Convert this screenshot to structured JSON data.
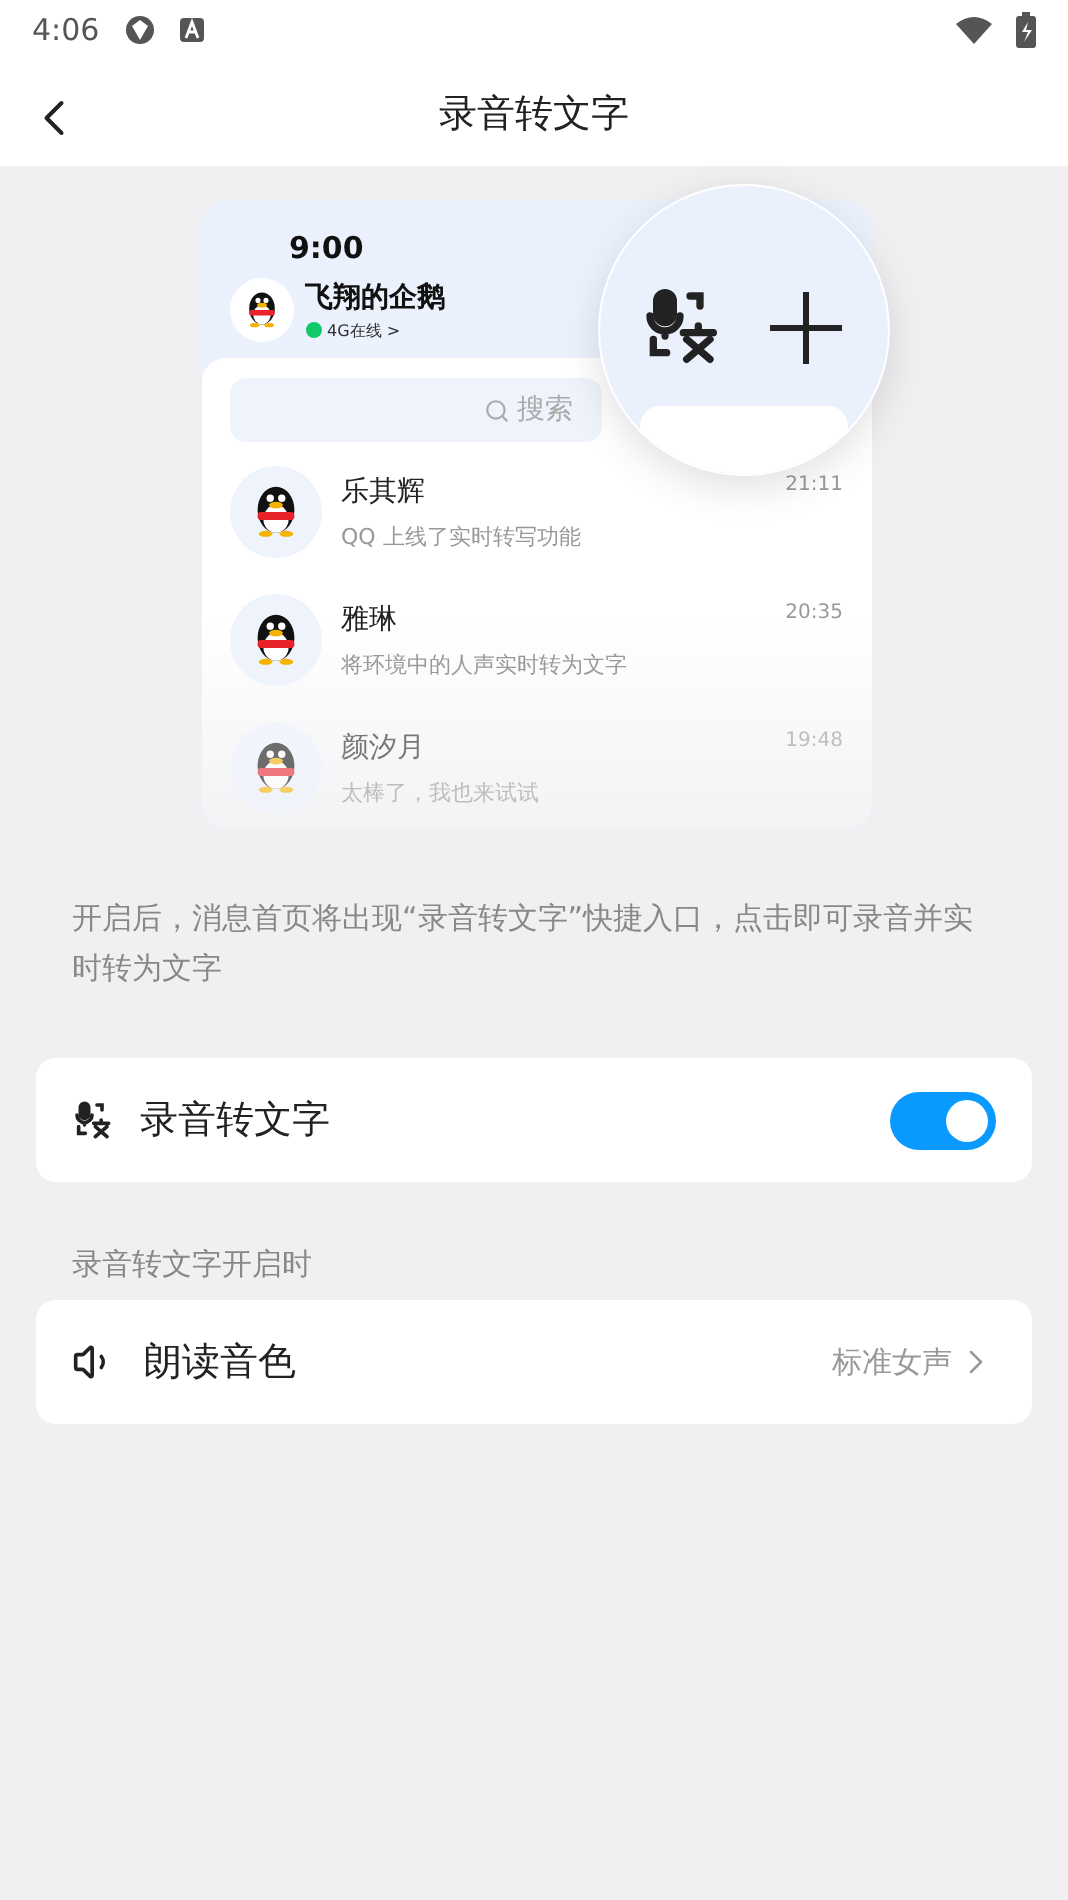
{
  "status_bar": {
    "time": "4:06"
  },
  "header": {
    "title": "录音转文字"
  },
  "preview": {
    "time": "9:00",
    "profile": {
      "name": "飞翔的企鹅",
      "status": "4G在线 >"
    },
    "search_placeholder": "搜索",
    "chats": [
      {
        "name": "乐其辉",
        "message": "QQ 上线了实时转写功能",
        "time": "21:11",
        "faded": false
      },
      {
        "name": "雅琳",
        "message": "将环境中的人声实时转为文字",
        "time": "20:35",
        "faded": false
      },
      {
        "name": "颜汐月",
        "message": "太棒了，我也来试试",
        "time": "19:48",
        "faded": true
      }
    ]
  },
  "description": "开启后，消息首页将出现“录音转文字”快捷入口，点击即可录音并实时转为文字",
  "groups": [
    {
      "items": [
        {
          "kind": "toggle",
          "label": "录音转文字",
          "on": true
        }
      ]
    },
    {
      "title": "录音转文字开启时",
      "items": [
        {
          "kind": "select",
          "label": "朗读音色",
          "value": "标准女声"
        }
      ]
    }
  ]
}
